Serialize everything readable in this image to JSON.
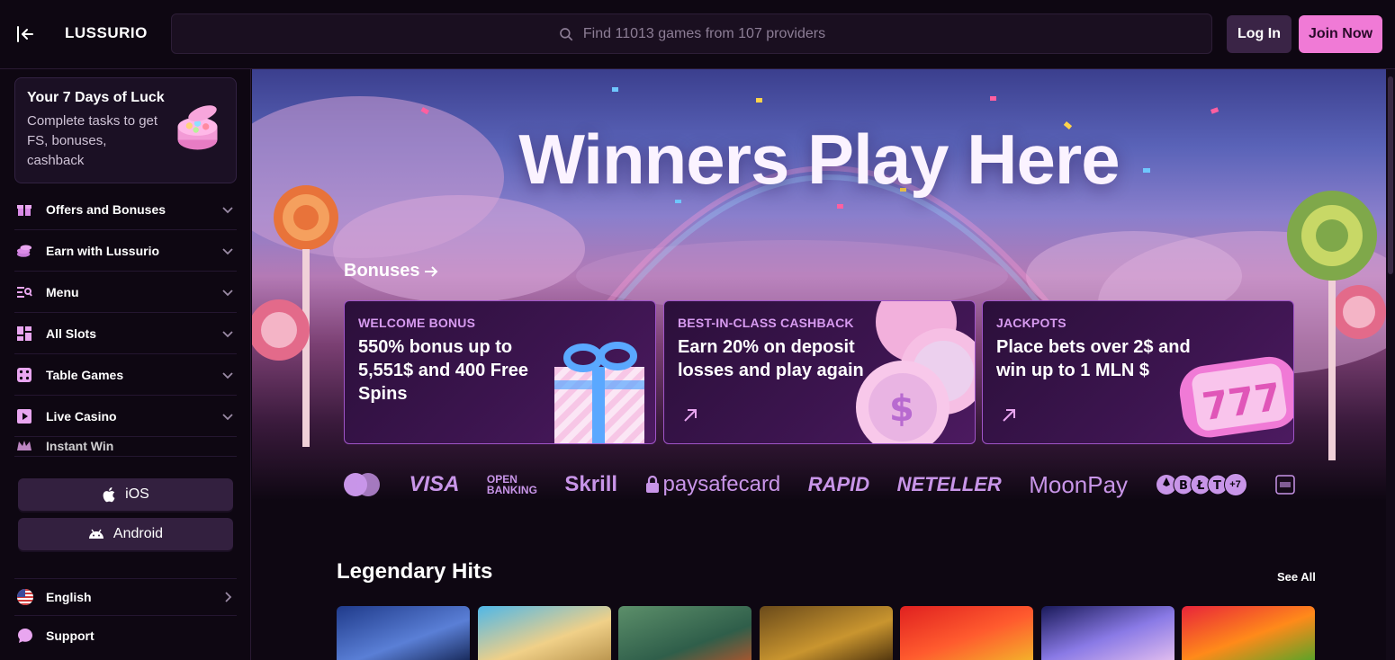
{
  "header": {
    "logo": "LUSSURIO",
    "search_placeholder": "Find 11013 games from 107 providers",
    "login_label": "Log In",
    "join_label": "Join Now"
  },
  "sidebar": {
    "promo": {
      "title": "Your 7 Days of Luck",
      "text": "Complete tasks to get FS, bonuses, cashback"
    },
    "items": [
      {
        "label": "Offers and Bonuses",
        "icon": "gift-icon"
      },
      {
        "label": "Earn with Lussurio",
        "icon": "coins-icon"
      },
      {
        "label": "Menu",
        "icon": "menu-search-icon"
      },
      {
        "label": "All Slots",
        "icon": "grid-icon"
      },
      {
        "label": "Table Games",
        "icon": "dice-icon"
      },
      {
        "label": "Live Casino",
        "icon": "play-icon"
      },
      {
        "label": "Instant Win",
        "icon": "crown-icon"
      }
    ],
    "ios_label": "iOS",
    "android_label": "Android",
    "language_label": "English",
    "support_label": "Support"
  },
  "hero": {
    "title": "Winners Play Here",
    "bonuses_link": "Bonuses",
    "cards": [
      {
        "tag": "WELCOME BONUS",
        "text": "550% bonus up to 5,551$ and 400 Free Spins"
      },
      {
        "tag": "BEST-IN-CLASS CASHBACK",
        "text": "Earn 20% on deposit losses and play again"
      },
      {
        "tag": "JACKPOTS",
        "text": "Place bets over 2$ and win up to 1 MLN $"
      }
    ]
  },
  "payments": {
    "visa": "VISA",
    "open_banking_1": "OPEN",
    "open_banking_2": "BANKING",
    "skrill": "Skrill",
    "paysafecard": "paysafecard",
    "rapid": "RAPID",
    "neteller": "NETELLER",
    "moonpay": "MoonPay",
    "crypto_more": "+7"
  },
  "section": {
    "title": "Legendary Hits",
    "see_all": "See All"
  },
  "colors": {
    "accent_pink": "#f07ad6",
    "card_border": "#a055c8",
    "background": "#0e0712"
  }
}
